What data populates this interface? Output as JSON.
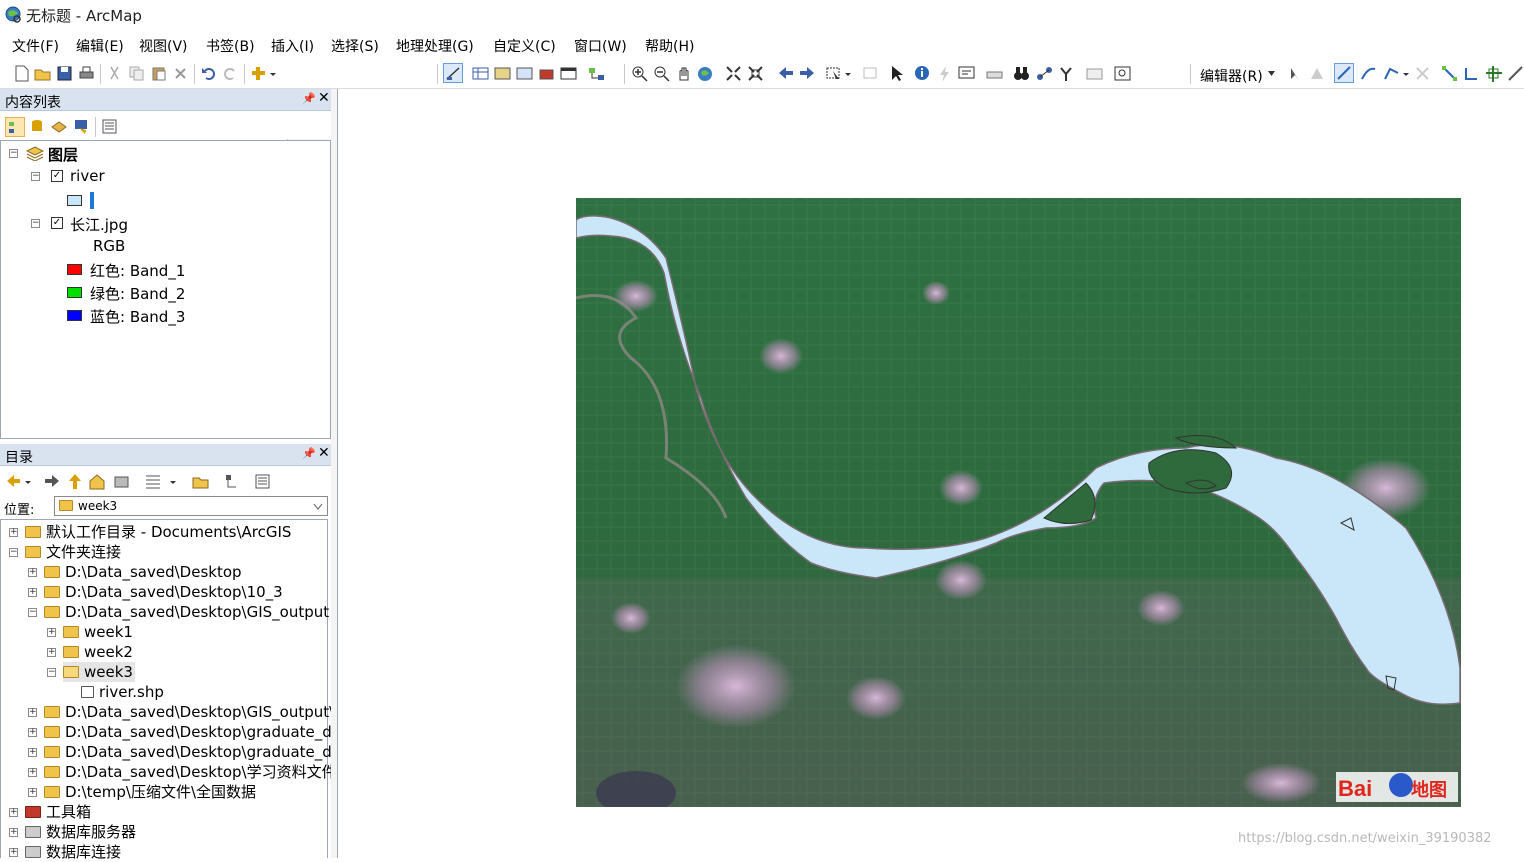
{
  "window": {
    "title": "无标题 - ArcMap"
  },
  "menu": [
    {
      "label": "文件(F)"
    },
    {
      "label": "编辑(E)"
    },
    {
      "label": "视图(V)"
    },
    {
      "label": "书签(B)"
    },
    {
      "label": "插入(I)"
    },
    {
      "label": "选择(S)"
    },
    {
      "label": "地理处理(G)"
    },
    {
      "label": "自定义(C)"
    },
    {
      "label": "窗口(W)"
    },
    {
      "label": "帮助(H)"
    }
  ],
  "toolbar": {
    "editor_label": "编辑器(R)",
    "scale_value": ""
  },
  "toc": {
    "title": "内容列表",
    "root": "图层",
    "layers": [
      {
        "name": "river",
        "checked": true
      },
      {
        "name": "长江.jpg",
        "checked": true,
        "rgb_label": "RGB",
        "bands": [
          {
            "label": "红色:   Band_1",
            "color": "#ff0000"
          },
          {
            "label": "绿色: Band_2",
            "color": "#00e000"
          },
          {
            "label": "蓝色:   Band_3",
            "color": "#0000ff"
          }
        ]
      }
    ]
  },
  "catalog": {
    "title": "目录",
    "location_label": "位置:",
    "location_value": "week3",
    "items": [
      {
        "label": "默认工作目录 - Documents\\ArcGIS"
      },
      {
        "label": "文件夹连接"
      },
      {
        "label": "D:\\Data_saved\\Desktop"
      },
      {
        "label": "D:\\Data_saved\\Desktop\\10_3"
      },
      {
        "label": "D:\\Data_saved\\Desktop\\GIS_output"
      },
      {
        "label": "week1"
      },
      {
        "label": "week2"
      },
      {
        "label": "week3"
      },
      {
        "label": "river.shp"
      },
      {
        "label": "D:\\Data_saved\\Desktop\\GIS_output\\"
      },
      {
        "label": "D:\\Data_saved\\Desktop\\graduate_dc"
      },
      {
        "label": "D:\\Data_saved\\Desktop\\graduate_dc"
      },
      {
        "label": "D:\\Data_saved\\Desktop\\学习资料文件"
      },
      {
        "label": "D:\\temp\\压缩文件\\全国数据"
      },
      {
        "label": "工具箱"
      },
      {
        "label": "数据库服务器"
      },
      {
        "label": "数据库连接"
      }
    ]
  },
  "map": {
    "logo_text_a": "Bai",
    "logo_text_b": "地图",
    "watermark": "https://blog.csdn.net/weixin_39190382",
    "river_fill": "#c9e7f8",
    "imagery_base": "#2f6a3c"
  }
}
